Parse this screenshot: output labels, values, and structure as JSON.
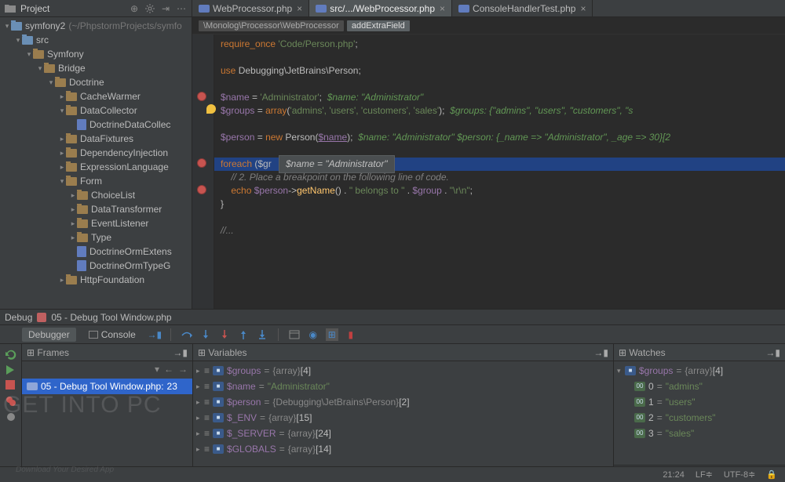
{
  "project_tool": {
    "label": "Project"
  },
  "tabs": [
    {
      "icon": "php-icon",
      "label": "WebProcessor.php",
      "active": false
    },
    {
      "icon": "php-icon",
      "label": "src/.../WebProcessor.php",
      "active": true
    },
    {
      "icon": "php-icon",
      "label": "ConsoleHandlerTest.php",
      "active": false
    }
  ],
  "breadcrumb": {
    "segments": [
      "\\Monolog\\Processor\\WebProcessor",
      "addExtraField"
    ]
  },
  "tree": [
    {
      "depth": 0,
      "arrow": "▾",
      "folder": "blue",
      "name": "symfony2",
      "hint": "(~/PhpstormProjects/symfo"
    },
    {
      "depth": 1,
      "arrow": "▾",
      "folder": "blue",
      "name": "src"
    },
    {
      "depth": 2,
      "arrow": "▾",
      "folder": "y",
      "name": "Symfony"
    },
    {
      "depth": 3,
      "arrow": "▾",
      "folder": "y",
      "name": "Bridge"
    },
    {
      "depth": 4,
      "arrow": "▾",
      "folder": "y",
      "name": "Doctrine"
    },
    {
      "depth": 5,
      "arrow": "▸",
      "folder": "y",
      "name": "CacheWarmer"
    },
    {
      "depth": 5,
      "arrow": "▾",
      "folder": "y",
      "name": "DataCollector"
    },
    {
      "depth": 6,
      "arrow": "",
      "file": true,
      "name": "DoctrineDataCollec"
    },
    {
      "depth": 5,
      "arrow": "▸",
      "folder": "y",
      "name": "DataFixtures"
    },
    {
      "depth": 5,
      "arrow": "▸",
      "folder": "y",
      "name": "DependencyInjection"
    },
    {
      "depth": 5,
      "arrow": "▸",
      "folder": "y",
      "name": "ExpressionLanguage"
    },
    {
      "depth": 5,
      "arrow": "▾",
      "folder": "y",
      "name": "Form"
    },
    {
      "depth": 6,
      "arrow": "▸",
      "folder": "y",
      "name": "ChoiceList"
    },
    {
      "depth": 6,
      "arrow": "▸",
      "folder": "y",
      "name": "DataTransformer"
    },
    {
      "depth": 6,
      "arrow": "▸",
      "folder": "y",
      "name": "EventListener"
    },
    {
      "depth": 6,
      "arrow": "▸",
      "folder": "y",
      "name": "Type"
    },
    {
      "depth": 6,
      "arrow": "",
      "file": true,
      "name": "DoctrineOrmExtens"
    },
    {
      "depth": 6,
      "arrow": "",
      "file": true,
      "name": "DoctrineOrmTypeG"
    },
    {
      "depth": 5,
      "arrow": "▸",
      "folder": "y",
      "name": "HttpFoundation"
    }
  ],
  "code": {
    "tooltip": "$name = \"Administrator\"",
    "line1_kw": "require_once",
    "line1_str": "'Code/Person.php'",
    "line2_kw": "use",
    "line2_ns": "Debugging\\JetBrains\\Person;",
    "name_var": "$name",
    "name_val": "'Administrator'",
    "name_cm": "$name: \"Administrator\"",
    "groups_var": "$groups",
    "array_kw": "array",
    "groups_vals": "'admins', 'users', 'customers', 'sales'",
    "groups_cm": "$groups: {\"admins\", \"users\", \"customers\", \"s",
    "person_var": "$person",
    "new_kw": "new",
    "person_cls": "Person",
    "person_arg": "$name",
    "person_cm": "$name: \"Administrator\"  $person: {_name => \"Administrator\", _age => 30}[2",
    "foreach_kw": "foreach",
    "foreach_arg": "($gr",
    "cm_line": "// 2. Place a breakpoint on the following line of code.",
    "echo_kw": "echo",
    "echo_var": "$person",
    "echo_fn": "getName",
    "echo_str1": "\" belongs to \"",
    "echo_var2": "$group",
    "echo_str2": "\"\\r\\n\"",
    "fold": "//..."
  },
  "debug": {
    "title_prefix": "Debug",
    "title_file": "05 - Debug Tool Window.php",
    "tab_debugger": "Debugger",
    "tab_console": "Console",
    "frames_label": "Frames",
    "vars_label": "Variables",
    "watches_label": "Watches",
    "frame": {
      "file": "05 - Debug Tool Window.php:",
      "line": "23"
    },
    "vars": [
      {
        "name": "$groups",
        "type": "{array}",
        "count": "[4]"
      },
      {
        "name": "$name",
        "str": "\"Administrator\""
      },
      {
        "name": "$person",
        "type": "{Debugging\\JetBrains\\Person}",
        "count": "[2]"
      },
      {
        "name": "$_ENV",
        "type": "{array}",
        "count": "[15]"
      },
      {
        "name": "$_SERVER",
        "type": "{array}",
        "count": "[24]"
      },
      {
        "name": "$GLOBALS",
        "type": "{array}",
        "count": "[14]"
      }
    ],
    "watches": {
      "root": {
        "name": "$groups",
        "type": "{array}",
        "count": "[4]"
      },
      "items": [
        {
          "idx": "0",
          "val": "\"admins\""
        },
        {
          "idx": "1",
          "val": "\"users\""
        },
        {
          "idx": "2",
          "val": "\"customers\""
        },
        {
          "idx": "3",
          "val": "\"sales\""
        }
      ]
    }
  },
  "status": {
    "pos": "21:24",
    "le": "LF≑",
    "enc": "UTF-8≑"
  },
  "watermark": "GET INTO PC",
  "watermark2": "Download Your Desired App"
}
